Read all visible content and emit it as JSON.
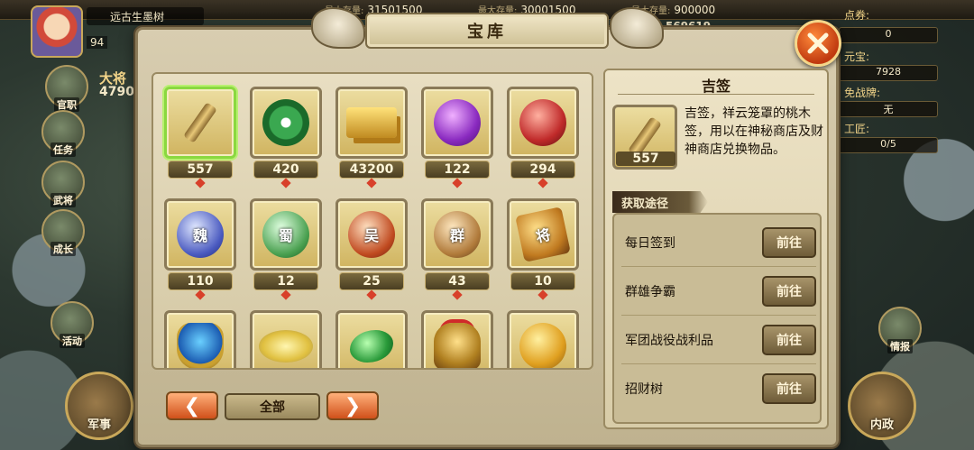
{
  "hud": {
    "player_name": "远古生墨树",
    "level": "94",
    "rank_label": "大将",
    "rank_value": "4790",
    "stat1_label": "最大存量:",
    "stat1_value": "31501500",
    "stat2_label": "最大存量:",
    "stat2_value": "30001500",
    "stat3_label": "最大存量:",
    "stat3_value": "900000",
    "stat3_sub": "569619",
    "side_buttons": [
      "官职",
      "任务",
      "武将",
      "成长",
      "活动"
    ],
    "military_label": "军事",
    "interior_label": "内政",
    "intel_label": "情报",
    "right_stats": [
      {
        "label": "点券:",
        "value": "0"
      },
      {
        "label": "元宝:",
        "value": "7928"
      },
      {
        "label": "免战牌:",
        "value": "无"
      },
      {
        "label": "工匠:",
        "value": "0/5"
      }
    ]
  },
  "dialog": {
    "title": "宝库",
    "filter_label": "全部",
    "prev_glyph": "❮",
    "next_glyph": "❯"
  },
  "items": [
    {
      "count": "557",
      "icon": "stick-icon",
      "selected": true
    },
    {
      "count": "420",
      "icon": "jade-disc-icon"
    },
    {
      "count": "43200",
      "icon": "gold-bar-icon"
    },
    {
      "count": "122",
      "icon": "purple-gem-icon"
    },
    {
      "count": "294",
      "icon": "red-gem-icon"
    },
    {
      "count": "110",
      "icon": "blue-orb-icon",
      "glyph": "魏"
    },
    {
      "count": "12",
      "icon": "green-orb-icon",
      "glyph": "蜀"
    },
    {
      "count": "25",
      "icon": "red-orb-icon",
      "glyph": "吴"
    },
    {
      "count": "43",
      "icon": "bronze-orb-icon",
      "glyph": "群"
    },
    {
      "count": "10",
      "icon": "general-token-icon",
      "glyph": "将"
    },
    {
      "count": "",
      "icon": "censer-icon"
    },
    {
      "count": "",
      "icon": "powder-icon"
    },
    {
      "count": "",
      "icon": "jade-leaf-icon"
    },
    {
      "count": "",
      "icon": "helmet-icon"
    },
    {
      "count": "",
      "icon": "yin-yang-icon"
    }
  ],
  "detail": {
    "name": "吉签",
    "count": "557",
    "description": "吉签，祥云笼罩的桃木签，用以在神秘商店及财神商店兑换物品。",
    "source_title": "获取途径",
    "goto_label": "前往",
    "sources": [
      "每日签到",
      "群雄争霸",
      "军团战役战利品",
      "招财树"
    ]
  }
}
